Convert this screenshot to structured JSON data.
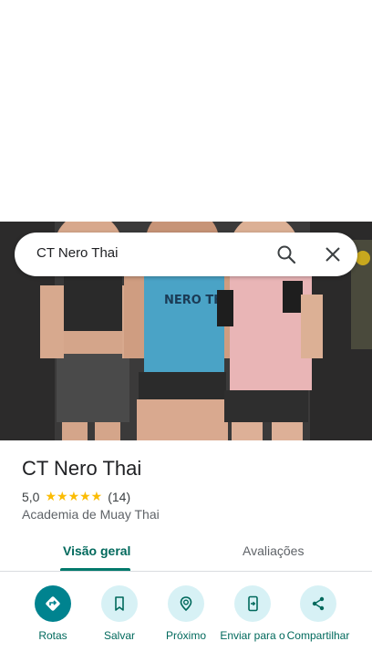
{
  "search": {
    "query": "CT Nero Thai"
  },
  "place": {
    "name": "CT Nero Thai",
    "rating": "5,0",
    "stars": "★★★★★",
    "review_count": "(14)",
    "category": "Academia de Muay Thai"
  },
  "tabs": [
    {
      "label": "Visão geral",
      "active": true
    },
    {
      "label": "Avaliações",
      "active": false
    }
  ],
  "actions": [
    {
      "label": "Rotas",
      "icon": "directions-icon"
    },
    {
      "label": "Salvar",
      "icon": "bookmark-icon"
    },
    {
      "label": "Próximo",
      "icon": "nearby-icon"
    },
    {
      "label": "Enviar para o",
      "icon": "send-to-phone-icon"
    },
    {
      "label": "Compartilhar",
      "icon": "share-icon"
    }
  ],
  "photo": {
    "shirt_text": "NERO THAI"
  },
  "colors": {
    "accent": "#00838f",
    "tab_active": "#00695c",
    "star": "#fbbc04",
    "action_bg": "#d7f1f5"
  }
}
